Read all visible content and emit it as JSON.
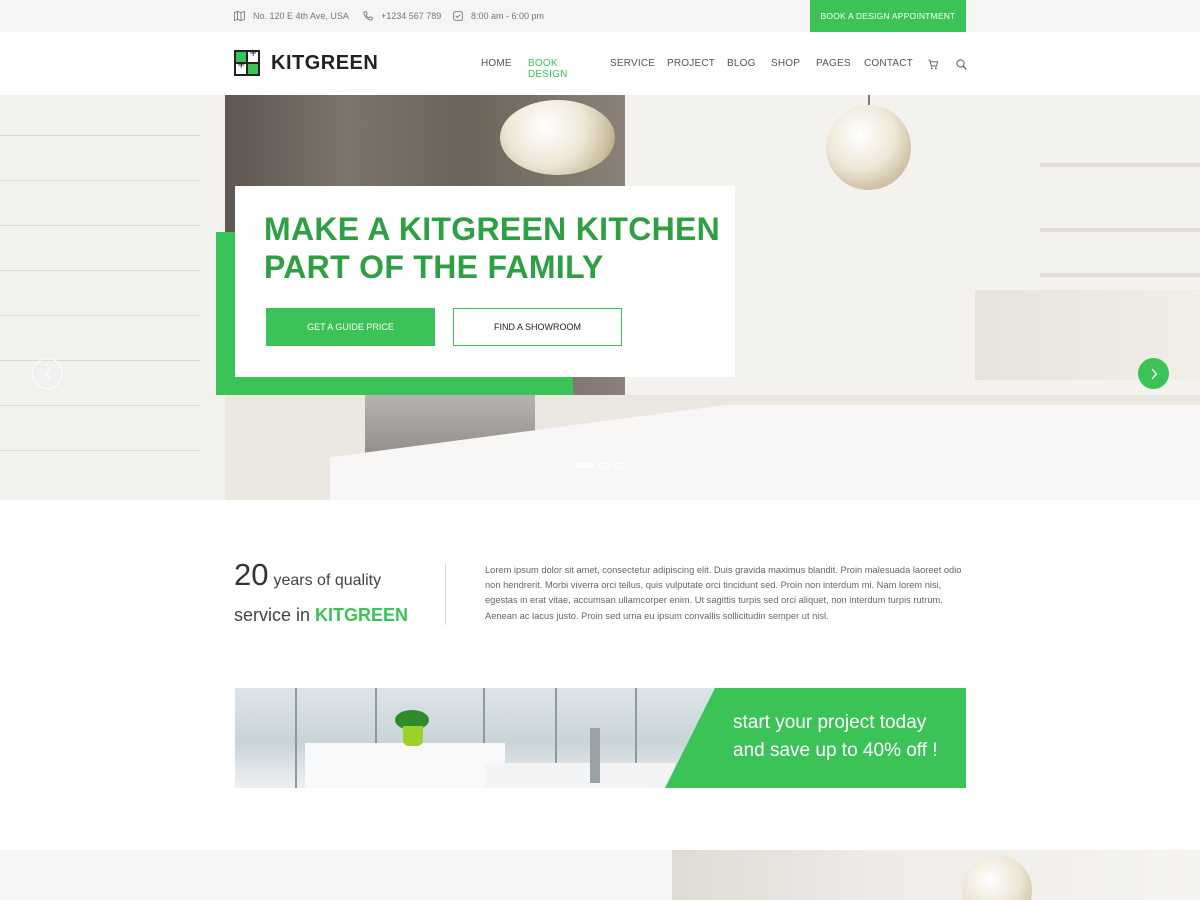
{
  "topbar": {
    "address": "No. 120 E 4th Ave,  USA",
    "phone": "+1234 567 789",
    "hours": "8:00 am - 6:00 pm",
    "appointment_button": "BOOK A DESIGN APPOINTMENT"
  },
  "brand": {
    "name": "KITGREEN",
    "accent_color": "#3cc357"
  },
  "nav": {
    "items": [
      "HOME",
      "BOOK DESIGN",
      "SERVICE",
      "PROJECT",
      "BLOG",
      "SHOP",
      "PAGES",
      "CONTACT"
    ],
    "active": "BOOK DESIGN",
    "icons": [
      "cart-icon",
      "search-icon"
    ]
  },
  "hero": {
    "title_line1": "MAKE A KITGREEN KITCHEN",
    "title_line2": "PART OF THE FAMILY",
    "primary_button": "GET A GUIDE PRICE",
    "secondary_button": "FIND A SHOWROOM",
    "slide_count": 3,
    "active_slide": 1
  },
  "about": {
    "years_number": "20",
    "years_text": "years of quality",
    "service_text": "service in",
    "brand": "KITGREEN",
    "paragraph": "Lorem ipsum dolor sit amet, consectetur adipiscing elit. Duis gravida maximus blandit. Proin malesuada laoreet odio non hendrerit. Morbi viverra orci tellus, quis vulputate orci tincidunt sed. Proin non interdum mi. Nam lorem nisi, egestas in erat vitae, accumsan ullamcorper enim. Ut sagittis turpis sed orci aliquet, non interdum turpis rutrum. Aenean ac lacus justo. Proin sed urna eu ipsum convallis sollicitudin semper ut nisl."
  },
  "promo": {
    "line1": "start your project today",
    "line2": "and save up to 40% off !"
  }
}
